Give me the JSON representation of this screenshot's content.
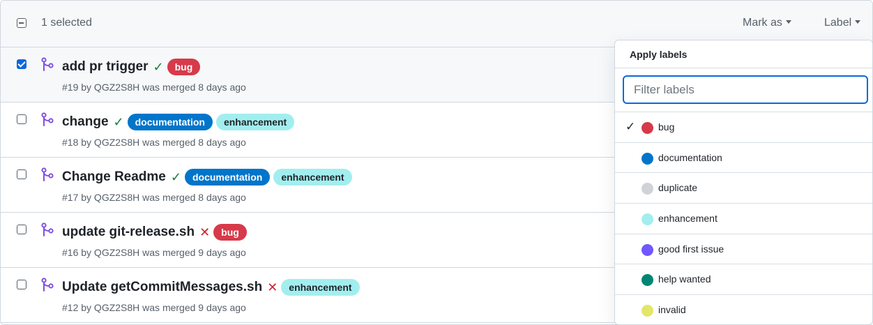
{
  "header": {
    "selected_count": "1 selected",
    "mark_as": "Mark as",
    "label": "Label"
  },
  "rows": [
    {
      "title": "add pr trigger",
      "status": "✓",
      "status_kind": "success",
      "checked": true,
      "labels": [
        {
          "name": "bug",
          "bg": "#d73a4a",
          "fg": "#ffffff"
        }
      ],
      "meta": "#19 by QGZ2S8H was merged 8 days ago"
    },
    {
      "title": "change",
      "status": "✓",
      "status_kind": "success",
      "checked": false,
      "labels": [
        {
          "name": "documentation",
          "bg": "#0075ca",
          "fg": "#ffffff"
        },
        {
          "name": "enhancement",
          "bg": "#a2eeef",
          "fg": "#1f2328"
        }
      ],
      "meta": "#18 by QGZ2S8H was merged 8 days ago"
    },
    {
      "title": "Change Readme",
      "status": "✓",
      "status_kind": "success",
      "checked": false,
      "labels": [
        {
          "name": "documentation",
          "bg": "#0075ca",
          "fg": "#ffffff"
        },
        {
          "name": "enhancement",
          "bg": "#a2eeef",
          "fg": "#1f2328"
        }
      ],
      "meta": "#17 by QGZ2S8H was merged 8 days ago"
    },
    {
      "title": "update git-release.sh",
      "status": "✕",
      "status_kind": "failure",
      "checked": false,
      "labels": [
        {
          "name": "bug",
          "bg": "#d73a4a",
          "fg": "#ffffff"
        }
      ],
      "meta": "#16 by QGZ2S8H was merged 9 days ago"
    },
    {
      "title": "Update getCommitMessages.sh",
      "status": "✕",
      "status_kind": "failure",
      "checked": false,
      "labels": [
        {
          "name": "enhancement",
          "bg": "#a2eeef",
          "fg": "#1f2328"
        }
      ],
      "meta": "#12 by QGZ2S8H was merged 9 days ago"
    }
  ],
  "dropdown": {
    "title": "Apply labels",
    "filter_placeholder": "Filter labels",
    "filter_value": "",
    "items": [
      {
        "name": "bug",
        "color": "#d73a4a",
        "checked": true
      },
      {
        "name": "documentation",
        "color": "#0075ca",
        "checked": false
      },
      {
        "name": "duplicate",
        "color": "#cfd3d7",
        "checked": false
      },
      {
        "name": "enhancement",
        "color": "#a2eeef",
        "checked": false
      },
      {
        "name": "good first issue",
        "color": "#7057ff",
        "checked": false
      },
      {
        "name": "help wanted",
        "color": "#008672",
        "checked": false
      },
      {
        "name": "invalid",
        "color": "#e4e669",
        "checked": false
      }
    ]
  },
  "icons": {
    "pr_merged": "git-merge-icon",
    "check": "check-icon",
    "fail": "x-icon"
  },
  "colors": {
    "merged_purple": "#8250df",
    "success_green": "#1a7f37",
    "failure_red": "#cf222e",
    "accent_blue": "#0969da"
  }
}
